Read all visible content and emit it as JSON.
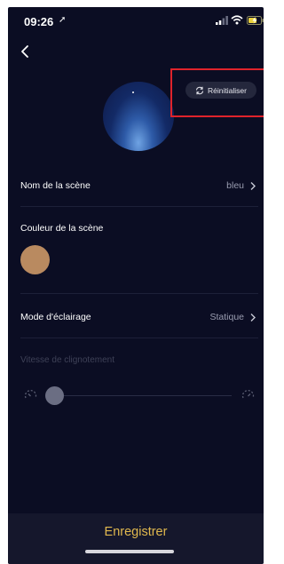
{
  "status_bar": {
    "time": "09:26",
    "location_arrow": "➚",
    "icons": [
      "signal-icon",
      "wifi-icon",
      "battery-charging-icon"
    ]
  },
  "header": {
    "back_icon": "chevron-left-icon",
    "reset_label": "Réinitialiser",
    "reset_icon": "refresh-icon"
  },
  "rows": {
    "scene_name": {
      "label": "Nom de la scène",
      "value": "bleu"
    },
    "scene_color": {
      "label": "Couleur de la scène",
      "swatch_color": "#b98a60"
    },
    "lighting_mode": {
      "label": "Mode d'éclairage",
      "value": "Statique"
    },
    "blink_speed": {
      "label": "Vitesse de clignotement",
      "level": 0,
      "enabled": false
    }
  },
  "footer": {
    "save_label": "Enregistrer"
  },
  "colors": {
    "background": "#0b0d23",
    "accent": "#e0b84e",
    "highlight": "#e0232b"
  }
}
